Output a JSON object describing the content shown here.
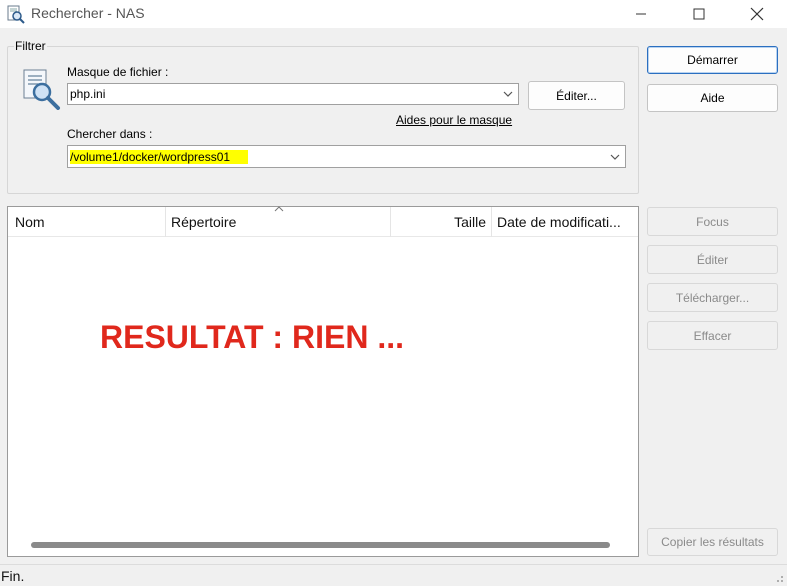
{
  "window": {
    "title": "Rechercher - NAS",
    "icon": "search-files-icon"
  },
  "filter": {
    "group_label": "Filtrer",
    "mask_label": "Masque de fichier :",
    "mask_value": "php.ini",
    "edit_button": "Éditer...",
    "mask_help_link": "Aides pour le masque",
    "search_in_label": "Chercher dans :",
    "search_in_value": "/volume1/docker/wordpress01",
    "highlight_color": "#ffff00"
  },
  "buttons": {
    "start": "Démarrer",
    "help": "Aide",
    "focus": "Focus",
    "edit": "Éditer",
    "download": "Télécharger...",
    "delete": "Effacer",
    "copy_results": "Copier les résultats"
  },
  "results": {
    "columns": [
      "Nom",
      "Répertoire",
      "Taille",
      "Date de modificati..."
    ],
    "annotation": "RESULTAT : RIEN ...",
    "annotation_color": "#e0281c"
  },
  "status": {
    "text": "Fin."
  }
}
